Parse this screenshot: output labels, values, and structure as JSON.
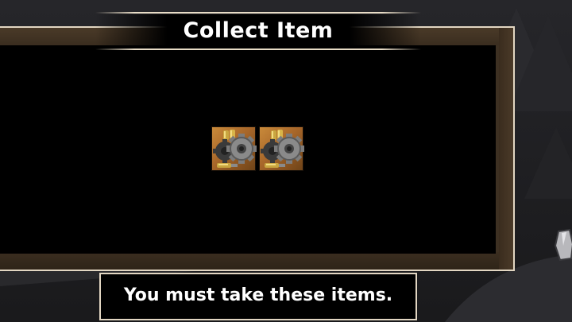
{
  "dialog": {
    "title": "Collect Item",
    "message": "You must take these items."
  },
  "items": [
    {
      "name": "gear-ammo-item",
      "icon": "gear-bullets-icon"
    },
    {
      "name": "gear-ammo-item",
      "icon": "gear-bullets-icon"
    }
  ],
  "colors": {
    "frame_border": "#e2d6c2",
    "wood": "#3d3022",
    "panel": "#000000",
    "item_bg": "#b8772f"
  },
  "scene": {
    "side_object_icon": "stone-token-icon",
    "background_icon": "pine-trees-icon"
  }
}
